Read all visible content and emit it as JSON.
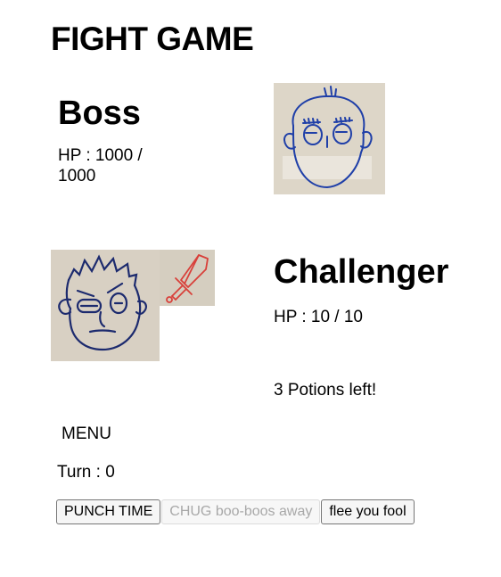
{
  "game": {
    "title": "FIGHT GAME"
  },
  "boss": {
    "name": "Boss",
    "hp_text": "HP : 1000 / 1000",
    "portrait_icon": "boss-face-sketch-icon",
    "ink_color": "#1f3fa8"
  },
  "challenger": {
    "name": "Challenger",
    "hp_text": "HP : 10 / 10",
    "portrait_icon": "challenger-face-sketch-icon",
    "weapon_icon": "sword-sketch-icon",
    "ink_color": "#1c2a6e",
    "weapon_color": "#d8403a"
  },
  "potions": {
    "text": "3 Potions left!"
  },
  "menu": {
    "title": "MENU",
    "turn_text": "Turn : 0",
    "buttons": [
      {
        "label": "PUNCH TIME",
        "enabled": true
      },
      {
        "label": "CHUG boo-boos away",
        "enabled": false
      },
      {
        "label": "flee you fool",
        "enabled": true
      }
    ]
  }
}
